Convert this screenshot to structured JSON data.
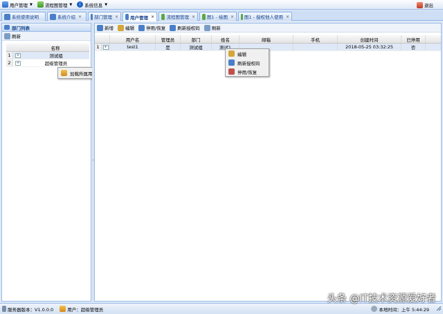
{
  "menubar": {
    "items": [
      {
        "label": "用户管理",
        "icon": "users-icon"
      },
      {
        "label": "流程图管理",
        "icon": "flowchart-icon"
      },
      {
        "label": "系统信息",
        "icon": "info-icon"
      }
    ],
    "logout_label": "退出"
  },
  "tabs": [
    {
      "label": "系统使用说明",
      "closable": false
    },
    {
      "label": "系统介绍",
      "closable": true
    },
    {
      "label": "部门管理",
      "closable": true
    },
    {
      "label": "用户管理",
      "closable": true,
      "active": true
    },
    {
      "label": "流程图管理",
      "closable": true
    },
    {
      "label": "图1 - 绘图",
      "closable": true
    },
    {
      "label": "图1 - 授权他人使用",
      "closable": true
    }
  ],
  "left": {
    "title": "部门列表",
    "refresh_label": "刷新",
    "column_header": "名称",
    "rows": [
      {
        "num": "1",
        "name": "测试组"
      },
      {
        "num": "2",
        "name": "超级管理员"
      }
    ],
    "context_menu": {
      "item": "加载所属用户"
    }
  },
  "right": {
    "toolbar": [
      "新增",
      "编辑",
      "停用/恢复",
      "刷新授权码",
      "刷新"
    ],
    "columns": [
      "用户名",
      "管理员",
      "部门",
      "姓名",
      "邮箱",
      "手机",
      "创建时间",
      "已停用"
    ],
    "rows": [
      {
        "num": "1",
        "cells": [
          "test1",
          "是",
          "测试组",
          "测试1",
          "",
          "",
          "2018-05-25 03:32:25",
          "否"
        ]
      }
    ],
    "context_menu": [
      "编辑",
      "刷新授权码",
      "停用/恢复"
    ]
  },
  "status": {
    "server_version": "服务器版本：V1.0.0.0",
    "user": "用户：超级管理员",
    "local_time": "本地时间：上午 5:44:29"
  },
  "watermark": "头条 @IT技术资源爱好者",
  "colors": {
    "accent": "#15428b",
    "panel_border": "#99bbe8",
    "header_bg": "#dfe8f6"
  }
}
